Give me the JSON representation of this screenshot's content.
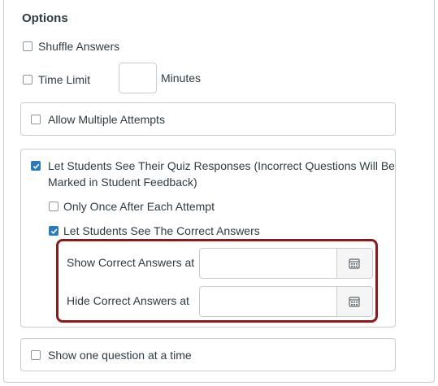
{
  "options": {
    "title": "Options",
    "shuffle_answers": {
      "label": "Shuffle Answers",
      "checked": false
    },
    "time_limit": {
      "label": "Time Limit",
      "checked": false,
      "value": "",
      "unit": "Minutes"
    },
    "allow_multiple_attempts": {
      "label": "Allow Multiple Attempts",
      "checked": false
    },
    "see_responses": {
      "label_line1": "Let Students See Their Quiz Responses (Incorrect Questions Will Be",
      "label_line2": "Marked in Student Feedback)",
      "checked": true,
      "only_once": {
        "label": "Only Once After Each Attempt",
        "checked": false
      },
      "see_correct": {
        "label": "Let Students See The Correct Answers",
        "checked": true
      },
      "show_correct_at": {
        "label": "Show Correct Answers at",
        "value": ""
      },
      "hide_correct_at": {
        "label": "Hide Correct Answers at",
        "value": ""
      }
    },
    "one_question": {
      "label": "Show one question at a time",
      "checked": false
    }
  },
  "colors": {
    "checkbox_checked": "#2b7abc",
    "highlight_border": "#8b1a1a",
    "text": "#2d3b45",
    "border": "#c7cdd1"
  },
  "icons": {
    "calendar": "calendar-icon",
    "check": "checkmark-icon"
  }
}
